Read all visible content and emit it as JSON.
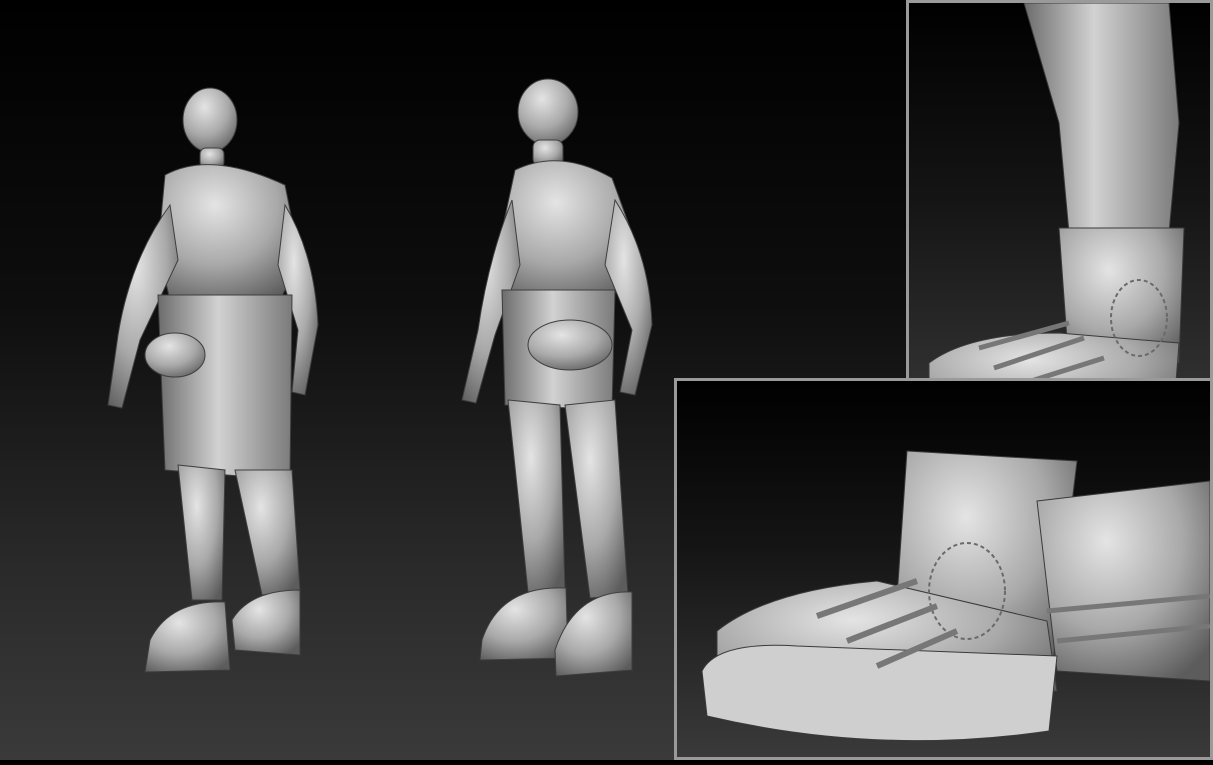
{
  "image": {
    "subject": "",
    "views": []
  }
}
